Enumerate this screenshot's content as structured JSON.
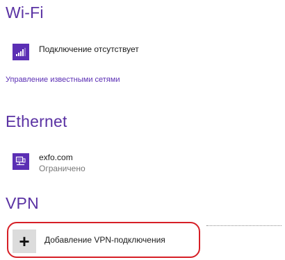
{
  "wifi": {
    "title": "Wi-Fi",
    "status": "Подключение отсутствует",
    "manage_link": "Управление известными сетями",
    "icon": "wifi-signal-icon",
    "accent": "#5b2fb4"
  },
  "ethernet": {
    "title": "Ethernet",
    "network_name": "exfo.com",
    "network_status": "Ограничено",
    "icon": "ethernet-icon"
  },
  "vpn": {
    "title": "VPN",
    "add_label": "Добавление VPN-подключения",
    "add_icon": "plus-icon",
    "highlight_color": "#d61f26"
  }
}
